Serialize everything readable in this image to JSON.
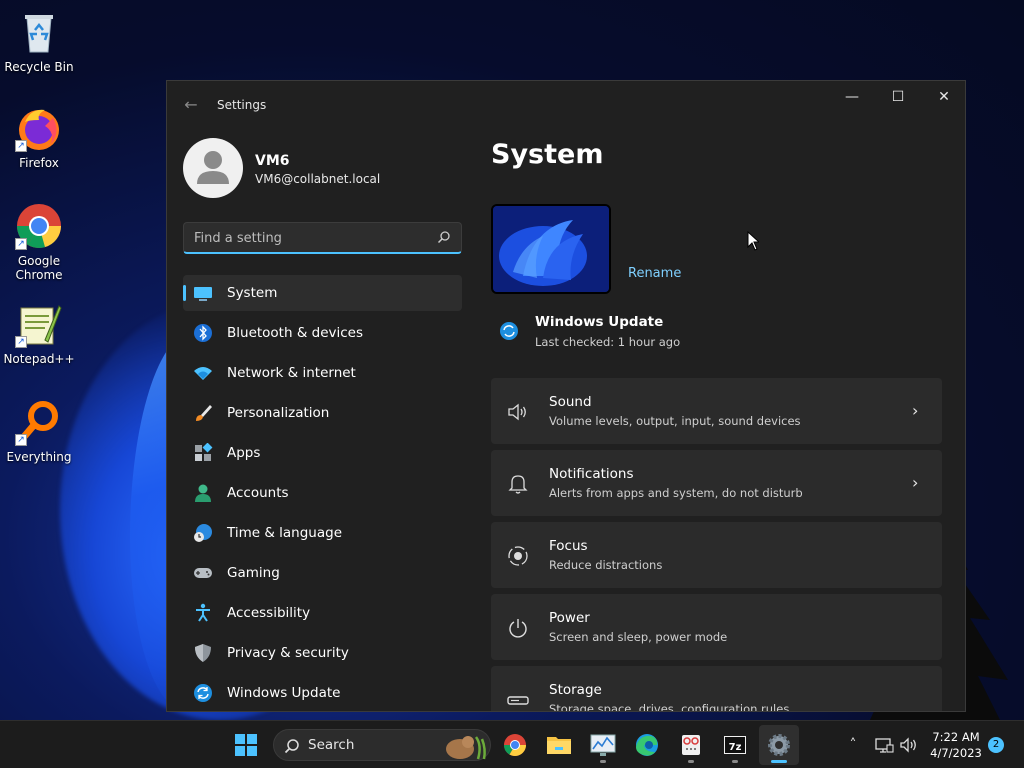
{
  "desktop": {
    "icons": [
      {
        "label": "Recycle Bin"
      },
      {
        "label": "Firefox"
      },
      {
        "label": "Google Chrome"
      },
      {
        "label": "Notepad++"
      },
      {
        "label": "Everything"
      }
    ]
  },
  "window": {
    "app_title": "Settings",
    "controls": {
      "minimize": "—",
      "maximize": "☐",
      "close": "✕"
    }
  },
  "user": {
    "name": "VM6",
    "email": "VM6@collabnet.local"
  },
  "search": {
    "placeholder": "Find a setting"
  },
  "nav": {
    "items": [
      {
        "label": "System",
        "icon": "system-icon",
        "active": true
      },
      {
        "label": "Bluetooth & devices",
        "icon": "bluetooth-icon"
      },
      {
        "label": "Network & internet",
        "icon": "wifi-icon"
      },
      {
        "label": "Personalization",
        "icon": "brush-icon"
      },
      {
        "label": "Apps",
        "icon": "apps-icon"
      },
      {
        "label": "Accounts",
        "icon": "accounts-icon"
      },
      {
        "label": "Time & language",
        "icon": "clock-globe-icon"
      },
      {
        "label": "Gaming",
        "icon": "gamepad-icon"
      },
      {
        "label": "Accessibility",
        "icon": "accessibility-icon"
      },
      {
        "label": "Privacy & security",
        "icon": "shield-icon"
      },
      {
        "label": "Windows Update",
        "icon": "update-icon"
      }
    ]
  },
  "main": {
    "title": "System",
    "rename_label": "Rename",
    "windows_update": {
      "title": "Windows Update",
      "subtitle": "Last checked: 1 hour ago"
    },
    "cards": [
      {
        "title": "Sound",
        "subtitle": "Volume levels, output, input, sound devices",
        "icon": "speaker-icon"
      },
      {
        "title": "Notifications",
        "subtitle": "Alerts from apps and system, do not disturb",
        "icon": "bell-icon"
      },
      {
        "title": "Focus",
        "subtitle": "Reduce distractions",
        "icon": "focus-icon"
      },
      {
        "title": "Power",
        "subtitle": "Screen and sleep, power mode",
        "icon": "power-icon"
      },
      {
        "title": "Storage",
        "subtitle": "Storage space, drives, configuration rules",
        "icon": "storage-icon"
      }
    ]
  },
  "taskbar": {
    "search_label": "Search",
    "time": "7:22 AM",
    "date": "4/7/2023",
    "notification_count": "2"
  },
  "colors": {
    "accent": "#4cc2ff",
    "window_bg": "#202020",
    "card_bg": "#2b2b2b"
  }
}
